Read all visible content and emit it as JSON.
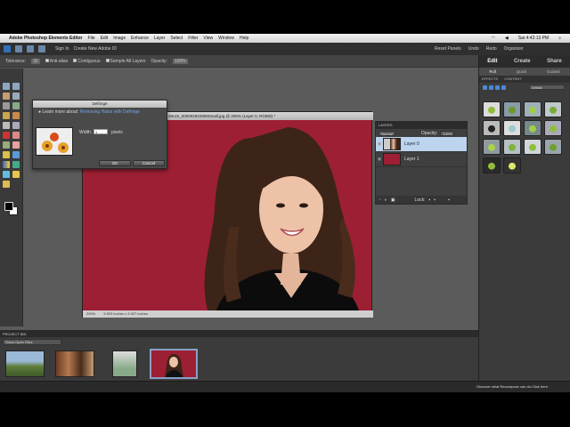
{
  "menubar": {
    "apple": "",
    "app_name": "Adobe Photoshop Elements Editor",
    "items": [
      "File",
      "Edit",
      "Image",
      "Enhance",
      "Layer",
      "Select",
      "Filter",
      "View",
      "Window",
      "Help"
    ],
    "clock": "Sat 4:42:13 PM"
  },
  "topbar": {
    "sign_in": "Sign In",
    "create_id": "Create New Adobe ID",
    "reset_panels": "Reset Panels",
    "undo": "Undo",
    "redo": "Redo",
    "organizer": "Organizer"
  },
  "options": {
    "tolerance_label": "Tolerance:",
    "tolerance_value": "32",
    "anti_alias": "Anti-alias",
    "contiguous": "Contiguous",
    "sample_all": "Sample All Layers",
    "opacity_label": "Opacity:",
    "opacity_value": "100%"
  },
  "document": {
    "title": "iStock_000002922909Small.jpg @ 200% (Layer 0, RGB/8) *",
    "zoom": "200%",
    "status": "5.903 inches x 3.927 inches"
  },
  "dialog": {
    "title": "Defringe",
    "learn": "Learn more about:",
    "link": "Removing Halos with Defringe",
    "width_label": "Width:",
    "width_value": "1",
    "units": "pixels",
    "ok": "OK",
    "cancel": "Cancel"
  },
  "layers": {
    "title": "LAYERS",
    "blend": "Normal",
    "opacity_label": "Opacity:",
    "opacity": "100%",
    "lock": "Lock:",
    "rows": [
      {
        "name": "Layer 0",
        "selected": true
      },
      {
        "name": "Layer 1",
        "selected": false
      }
    ]
  },
  "right_panel": {
    "tabs": [
      "Edit",
      "Create",
      "Share"
    ],
    "sub_tabs": [
      "Full",
      "Quick",
      "Guided"
    ],
    "effects_head": "EFFECTS",
    "content_head": "CONTENT",
    "filter_select": "Artistic"
  },
  "bin": {
    "title": "PROJECT BIN",
    "select": "Show Open Files"
  },
  "status": {
    "tip": "Discover what Recompose can do.Click here."
  }
}
